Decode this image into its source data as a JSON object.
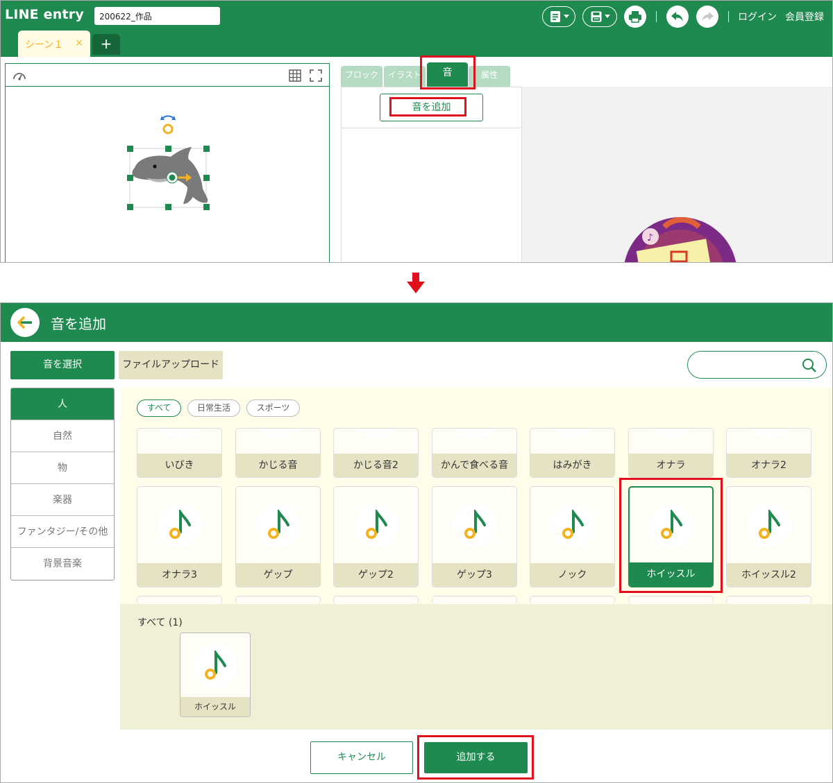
{
  "top": {
    "app_title": "LINE entry",
    "project_name": "200622_作品",
    "header_links": {
      "login": "ログイン",
      "signup": "会員登録"
    },
    "scene_tab": {
      "label": "シーン１",
      "close": "×"
    },
    "add_scene": "+",
    "panel_tabs": {
      "block": "ブロック",
      "illust": "イラスト",
      "sound": "音",
      "attr": "属性"
    },
    "add_sound_button": "音を追加"
  },
  "dialog": {
    "title": "音を追加",
    "mode_select": "音を選択",
    "mode_upload": "ファイルアップロード",
    "search": {
      "placeholder": ""
    },
    "categories": [
      "人",
      "自然",
      "物",
      "楽器",
      "ファンタジー/その他",
      "背景音楽"
    ],
    "filters": [
      "すべて",
      "日常生活",
      "スポーツ"
    ],
    "sounds_row1": [
      "いびき",
      "かじる音",
      "かじる音2",
      "かんで食べる音",
      "はみがき",
      "オナラ",
      "オナラ2"
    ],
    "sounds_row2": [
      "オナラ3",
      "ゲップ",
      "ゲップ2",
      "ゲップ3",
      "ノック",
      "ホイッスル",
      "ホイッスル2"
    ],
    "selected_sound": "ホイッスル",
    "selected_header": "すべて (1)",
    "selected_items": [
      "ホイッスル"
    ],
    "cancel": "キャンセル",
    "confirm": "追加する"
  },
  "colors": {
    "brand_green": "#1f8a4f",
    "highlight_red": "#e0101c",
    "note_yellow": "#f3b321",
    "scene_tab_text": "#f3b321"
  }
}
